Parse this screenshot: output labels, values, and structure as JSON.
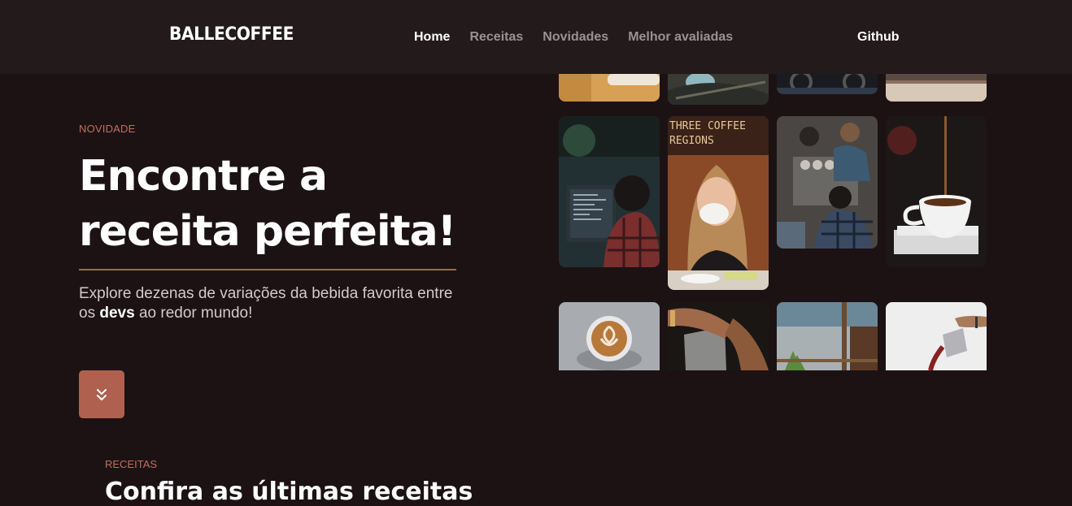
{
  "header": {
    "logo": "BALLECOFFEE",
    "nav": [
      {
        "label": "Home",
        "active": true
      },
      {
        "label": "Receitas",
        "active": false
      },
      {
        "label": "Novidades",
        "active": false
      },
      {
        "label": "Melhor avaliadas",
        "active": false
      }
    ],
    "github": "Github"
  },
  "hero": {
    "eyebrow": "NOVIDADE",
    "title_line1": "Encontre a",
    "title_line2": "receita perfeita!",
    "lead_part1": "Explore dezenas de variações da bebida favorita entre os ",
    "lead_bold": "devs",
    "lead_part2": " ao redor mundo!",
    "tile_sign_text": "THREE COFFEE REGIONS"
  },
  "recipes": {
    "eyebrow": "RECEITAS",
    "title": "Confira as últimas receitas"
  },
  "colors": {
    "background": "#1c1214",
    "header": "#221a1b",
    "accent": "#b0604e",
    "accent_text": "#c0705f"
  },
  "icons": {
    "scroll": "chevrons-down-icon"
  }
}
